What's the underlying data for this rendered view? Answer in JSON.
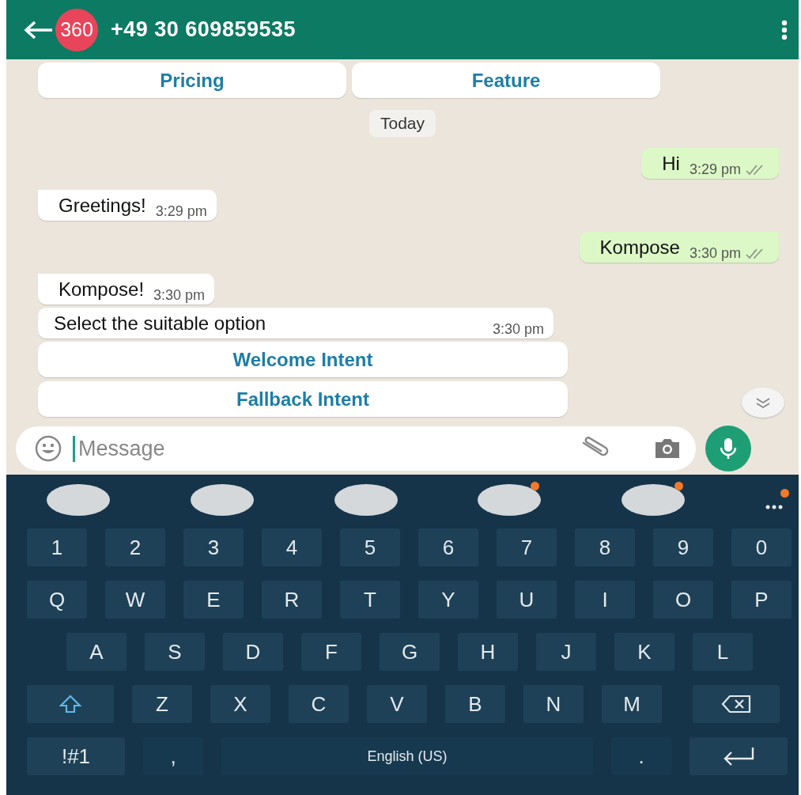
{
  "header": {
    "avatar": "360",
    "title": "+49 30 609859535"
  },
  "messages": [
    {
      "kind": "buttons",
      "buttons": [
        "Pricing",
        "Feature"
      ]
    },
    {
      "kind": "date",
      "text": "Today"
    },
    {
      "kind": "out",
      "text": "Hi",
      "time": "3:29 pm",
      "read": false
    },
    {
      "kind": "in",
      "text": "Greetings!",
      "time": "3:29 pm",
      "tail": true
    },
    {
      "kind": "out",
      "text": "Kompose",
      "time": "3:30 pm",
      "read": false
    },
    {
      "kind": "in",
      "text": "Kompose!",
      "time": "3:30 pm",
      "tail": true
    },
    {
      "kind": "in",
      "text": "Select the suitable option",
      "time": "3:30 pm",
      "tail": false
    },
    {
      "kind": "buttons",
      "buttons": [
        "Welcome Intent"
      ]
    },
    {
      "kind": "buttons",
      "buttons": [
        "Fallback Intent"
      ]
    }
  ],
  "composer": {
    "placeholder": "Message"
  },
  "suggestions": [
    {
      "badge": false
    },
    {
      "badge": false
    },
    {
      "badge": false
    },
    {
      "badge": true
    },
    {
      "badge": true
    }
  ],
  "more_badge": true,
  "keyboard": [
    [
      {
        "kind": "char",
        "label": "1"
      },
      {
        "kind": "char",
        "label": "2"
      },
      {
        "kind": "char",
        "label": "3"
      },
      {
        "kind": "char",
        "label": "4"
      },
      {
        "kind": "char",
        "label": "5"
      },
      {
        "kind": "char",
        "label": "6"
      },
      {
        "kind": "char",
        "label": "7"
      },
      {
        "kind": "char",
        "label": "8"
      },
      {
        "kind": "char",
        "label": "9"
      },
      {
        "kind": "char",
        "label": "0"
      }
    ],
    [
      {
        "kind": "char",
        "label": "Q"
      },
      {
        "kind": "char",
        "label": "W"
      },
      {
        "kind": "char",
        "label": "E"
      },
      {
        "kind": "char",
        "label": "R"
      },
      {
        "kind": "char",
        "label": "T"
      },
      {
        "kind": "char",
        "label": "Y"
      },
      {
        "kind": "char",
        "label": "U"
      },
      {
        "kind": "char",
        "label": "I"
      },
      {
        "kind": "char",
        "label": "O"
      },
      {
        "kind": "char",
        "label": "P"
      }
    ],
    [
      {
        "kind": "char",
        "label": "A"
      },
      {
        "kind": "char",
        "label": "S"
      },
      {
        "kind": "char",
        "label": "D"
      },
      {
        "kind": "char",
        "label": "F"
      },
      {
        "kind": "char",
        "label": "G"
      },
      {
        "kind": "char",
        "label": "H"
      },
      {
        "kind": "char",
        "label": "J"
      },
      {
        "kind": "char",
        "label": "K"
      },
      {
        "kind": "char",
        "label": "L"
      }
    ],
    [
      {
        "kind": "shift"
      },
      {
        "kind": "char",
        "label": "Z"
      },
      {
        "kind": "char",
        "label": "X"
      },
      {
        "kind": "char",
        "label": "C"
      },
      {
        "kind": "char",
        "label": "V"
      },
      {
        "kind": "char",
        "label": "B"
      },
      {
        "kind": "char",
        "label": "N"
      },
      {
        "kind": "char",
        "label": "M"
      },
      {
        "kind": "backspace"
      }
    ],
    [
      {
        "kind": "symbols",
        "label": "!#1"
      },
      {
        "kind": "char",
        "label": ","
      },
      {
        "kind": "space",
        "label": "English (US)"
      },
      {
        "kind": "char",
        "label": "."
      },
      {
        "kind": "enter"
      }
    ]
  ]
}
